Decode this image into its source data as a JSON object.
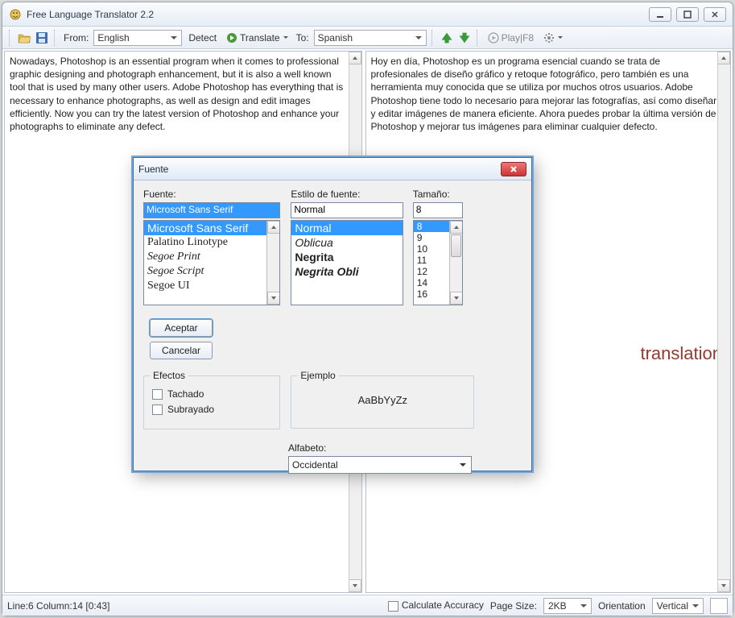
{
  "window": {
    "title": "Free Language Translator 2.2"
  },
  "toolbar": {
    "from_label": "From:",
    "from_value": "English",
    "detect_label": "Detect",
    "translate_label": "Translate",
    "to_label": "To:",
    "to_value": "Spanish",
    "play_label": "Play|F8"
  },
  "source_text": "Nowadays, Photoshop is an essential program when it comes to professional graphic designing and photograph enhancement, but it is also a well known tool that is used by many other users. Adobe Photoshop has everything that is necessary to enhance photographs, as well as design and edit images efficiently. Now you can try the latest version of Photoshop and enhance your photographs to eliminate any defect.",
  "target_text": "Hoy en día, Photoshop es un programa esencial cuando se trata de profesionales de diseño gráfico y retoque fotográfico, pero también es una herramienta muy conocida que se utiliza por muchos otros usuarios. Adobe Photoshop tiene todo lo necesario para mejorar las fotografías, así como diseñar y editar imágenes de manera eficiente. Ahora puedes probar la última versión de Photoshop y mejorar tus imágenes para eliminar cualquier defecto.",
  "watermark": "translation",
  "statusbar": {
    "position": "Line:6 Column:14 [0:43]",
    "calc_accuracy": "Calculate Accuracy",
    "page_size_label": "Page Size:",
    "page_size_value": "2KB",
    "orientation_label": "Orientation",
    "orientation_value": "Vertical"
  },
  "font_dialog": {
    "title": "Fuente",
    "font_label": "Fuente:",
    "font_value": "Microsoft Sans Serif",
    "font_list": [
      "Microsoft Sans Serif",
      "Palatino Linotype",
      "Segoe Print",
      "Segoe Script",
      "Segoe UI"
    ],
    "style_label": "Estilo de fuente:",
    "style_value": "Normal",
    "style_list": [
      "Normal",
      "Oblicua",
      "Negrita",
      "Negrita Obli"
    ],
    "size_label": "Tamaño:",
    "size_value": "8",
    "size_list": [
      "8",
      "9",
      "10",
      "11",
      "12",
      "14",
      "16"
    ],
    "ok": "Aceptar",
    "cancel": "Cancelar",
    "effects_label": "Efectos",
    "strike": "Tachado",
    "underline": "Subrayado",
    "example_label": "Ejemplo",
    "sample": "AaBbYyZz",
    "script_label": "Alfabeto:",
    "script_value": "Occidental"
  }
}
